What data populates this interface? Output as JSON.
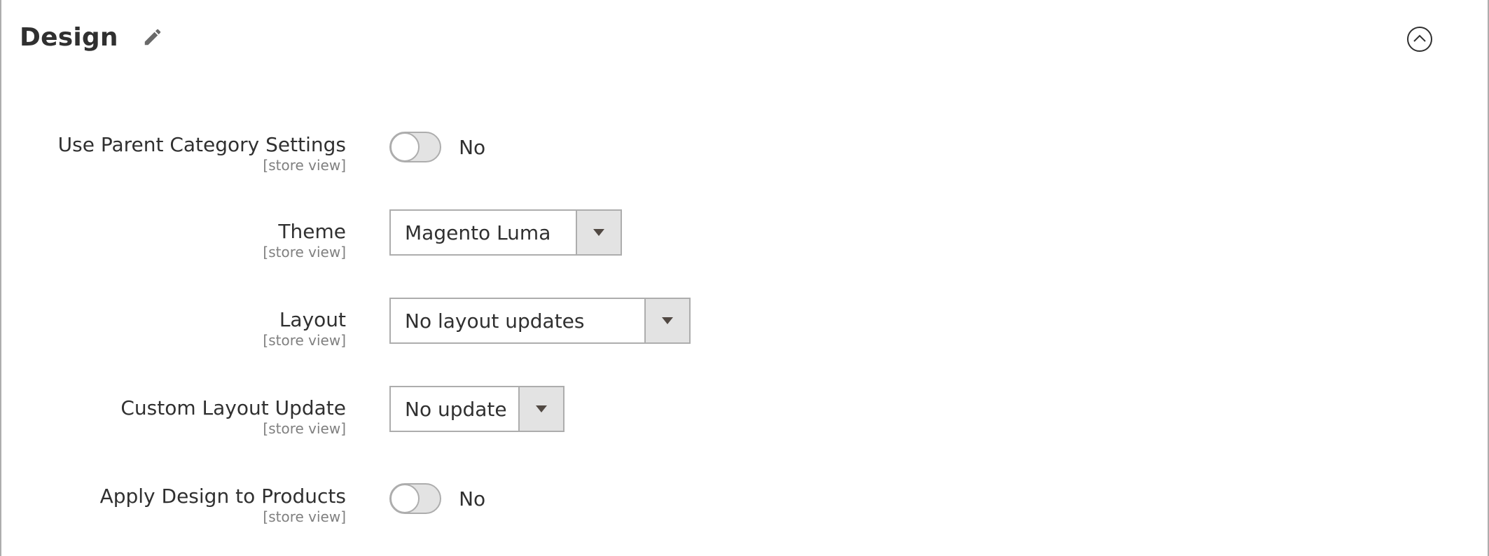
{
  "section": {
    "title": "Design"
  },
  "fields": {
    "use_parent": {
      "label": "Use Parent Category Settings",
      "scope": "[store view]",
      "value": "No"
    },
    "theme": {
      "label": "Theme",
      "scope": "[store view]",
      "value": "Magento Luma"
    },
    "layout": {
      "label": "Layout",
      "scope": "[store view]",
      "value": "No layout updates"
    },
    "custom_layout_update": {
      "label": "Custom Layout Update",
      "scope": "[store view]",
      "value": "No update"
    },
    "apply_to_products": {
      "label": "Apply Design to Products",
      "scope": "[store view]",
      "value": "No"
    }
  },
  "icons": {
    "edit": "pencil-icon",
    "collapse": "chevron-up-circle-icon",
    "dropdown": "caret-down-icon"
  },
  "colors": {
    "text": "#303030",
    "scope_text": "#808080",
    "border": "#adadad",
    "control_bg": "#e3e3e3"
  }
}
